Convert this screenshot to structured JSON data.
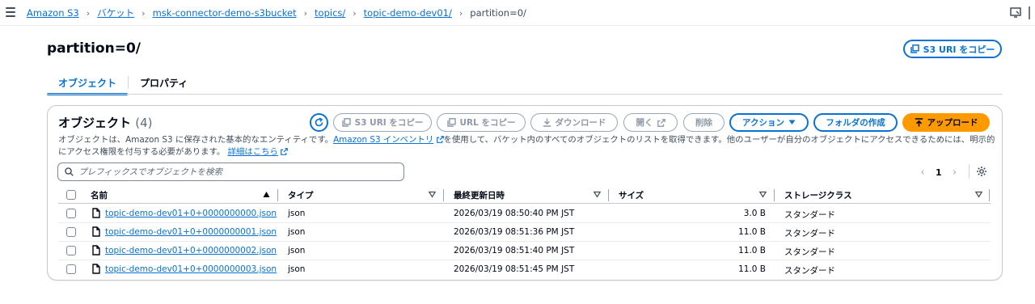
{
  "breadcrumb": {
    "items": [
      "Amazon S3",
      "バケット",
      "msk-connector-demo-s3bucket",
      "topics/",
      "topic-demo-dev01/"
    ],
    "current": "partition=0/",
    "separator": "›"
  },
  "header": {
    "title": "partition=0/",
    "copy_s3_uri_label": "S3 URI をコピー"
  },
  "tabs": [
    {
      "label": "オブジェクト",
      "active": true
    },
    {
      "label": "プロパティ",
      "active": false
    }
  ],
  "objects_panel": {
    "heading": "オブジェクト",
    "count": "(4)",
    "toolbar": {
      "copy_s3_uri": "S3 URI をコピー",
      "copy_url": "URL をコピー",
      "download": "ダウンロード",
      "open": "開く",
      "delete": "削除",
      "actions": "アクション",
      "create_folder": "フォルダの作成",
      "upload": "アップロード"
    },
    "description": {
      "part1": "オブジェクトは、Amazon S3 に保存された基本的なエンティティです。",
      "inventory_link": "Amazon S3 インベントリ",
      "part2": "を使用して、バケット内のすべてのオブジェクトのリストを取得できます。他のユーザーが自分のオブジェクトにアクセスできるためには、明示的にアクセス権限を付与する必要があります。",
      "learn_more_link": "詳細はこちら"
    },
    "search": {
      "placeholder": "プレフィックスでオブジェクトを検索",
      "value": ""
    },
    "pagination": {
      "current_page": "1"
    }
  },
  "table": {
    "columns": [
      "名前",
      "タイプ",
      "最終更新日時",
      "サイズ",
      "ストレージクラス"
    ],
    "rows": [
      {
        "name": "topic-demo-dev01+0+0000000000.json",
        "type": "json",
        "modified": "2026/03/19 08:50:40 PM JST",
        "size": "3.0 B",
        "storage_class": "スタンダード"
      },
      {
        "name": "topic-demo-dev01+0+0000000001.json",
        "type": "json",
        "modified": "2026/03/19 08:51:36 PM JST",
        "size": "11.0 B",
        "storage_class": "スタンダード"
      },
      {
        "name": "topic-demo-dev01+0+0000000002.json",
        "type": "json",
        "modified": "2026/03/19 08:51:40 PM JST",
        "size": "11.0 B",
        "storage_class": "スタンダード"
      },
      {
        "name": "topic-demo-dev01+0+0000000003.json",
        "type": "json",
        "modified": "2026/03/19 08:51:45 PM JST",
        "size": "11.0 B",
        "storage_class": "スタンダード"
      }
    ]
  },
  "colors": {
    "link": "#0972d3",
    "upload_button": "#ff9900",
    "disabled_text": "#8d99a8",
    "border": "#c6c6cd"
  },
  "icons": [
    "hamburger-icon",
    "external-link-icon",
    "copy-icon",
    "refresh-icon",
    "download-icon",
    "caret-down-icon",
    "upload-icon",
    "search-icon",
    "gear-icon",
    "file-icon",
    "sort-ascending-icon",
    "sort-icon",
    "chevron-left-icon",
    "chevron-right-icon"
  ]
}
